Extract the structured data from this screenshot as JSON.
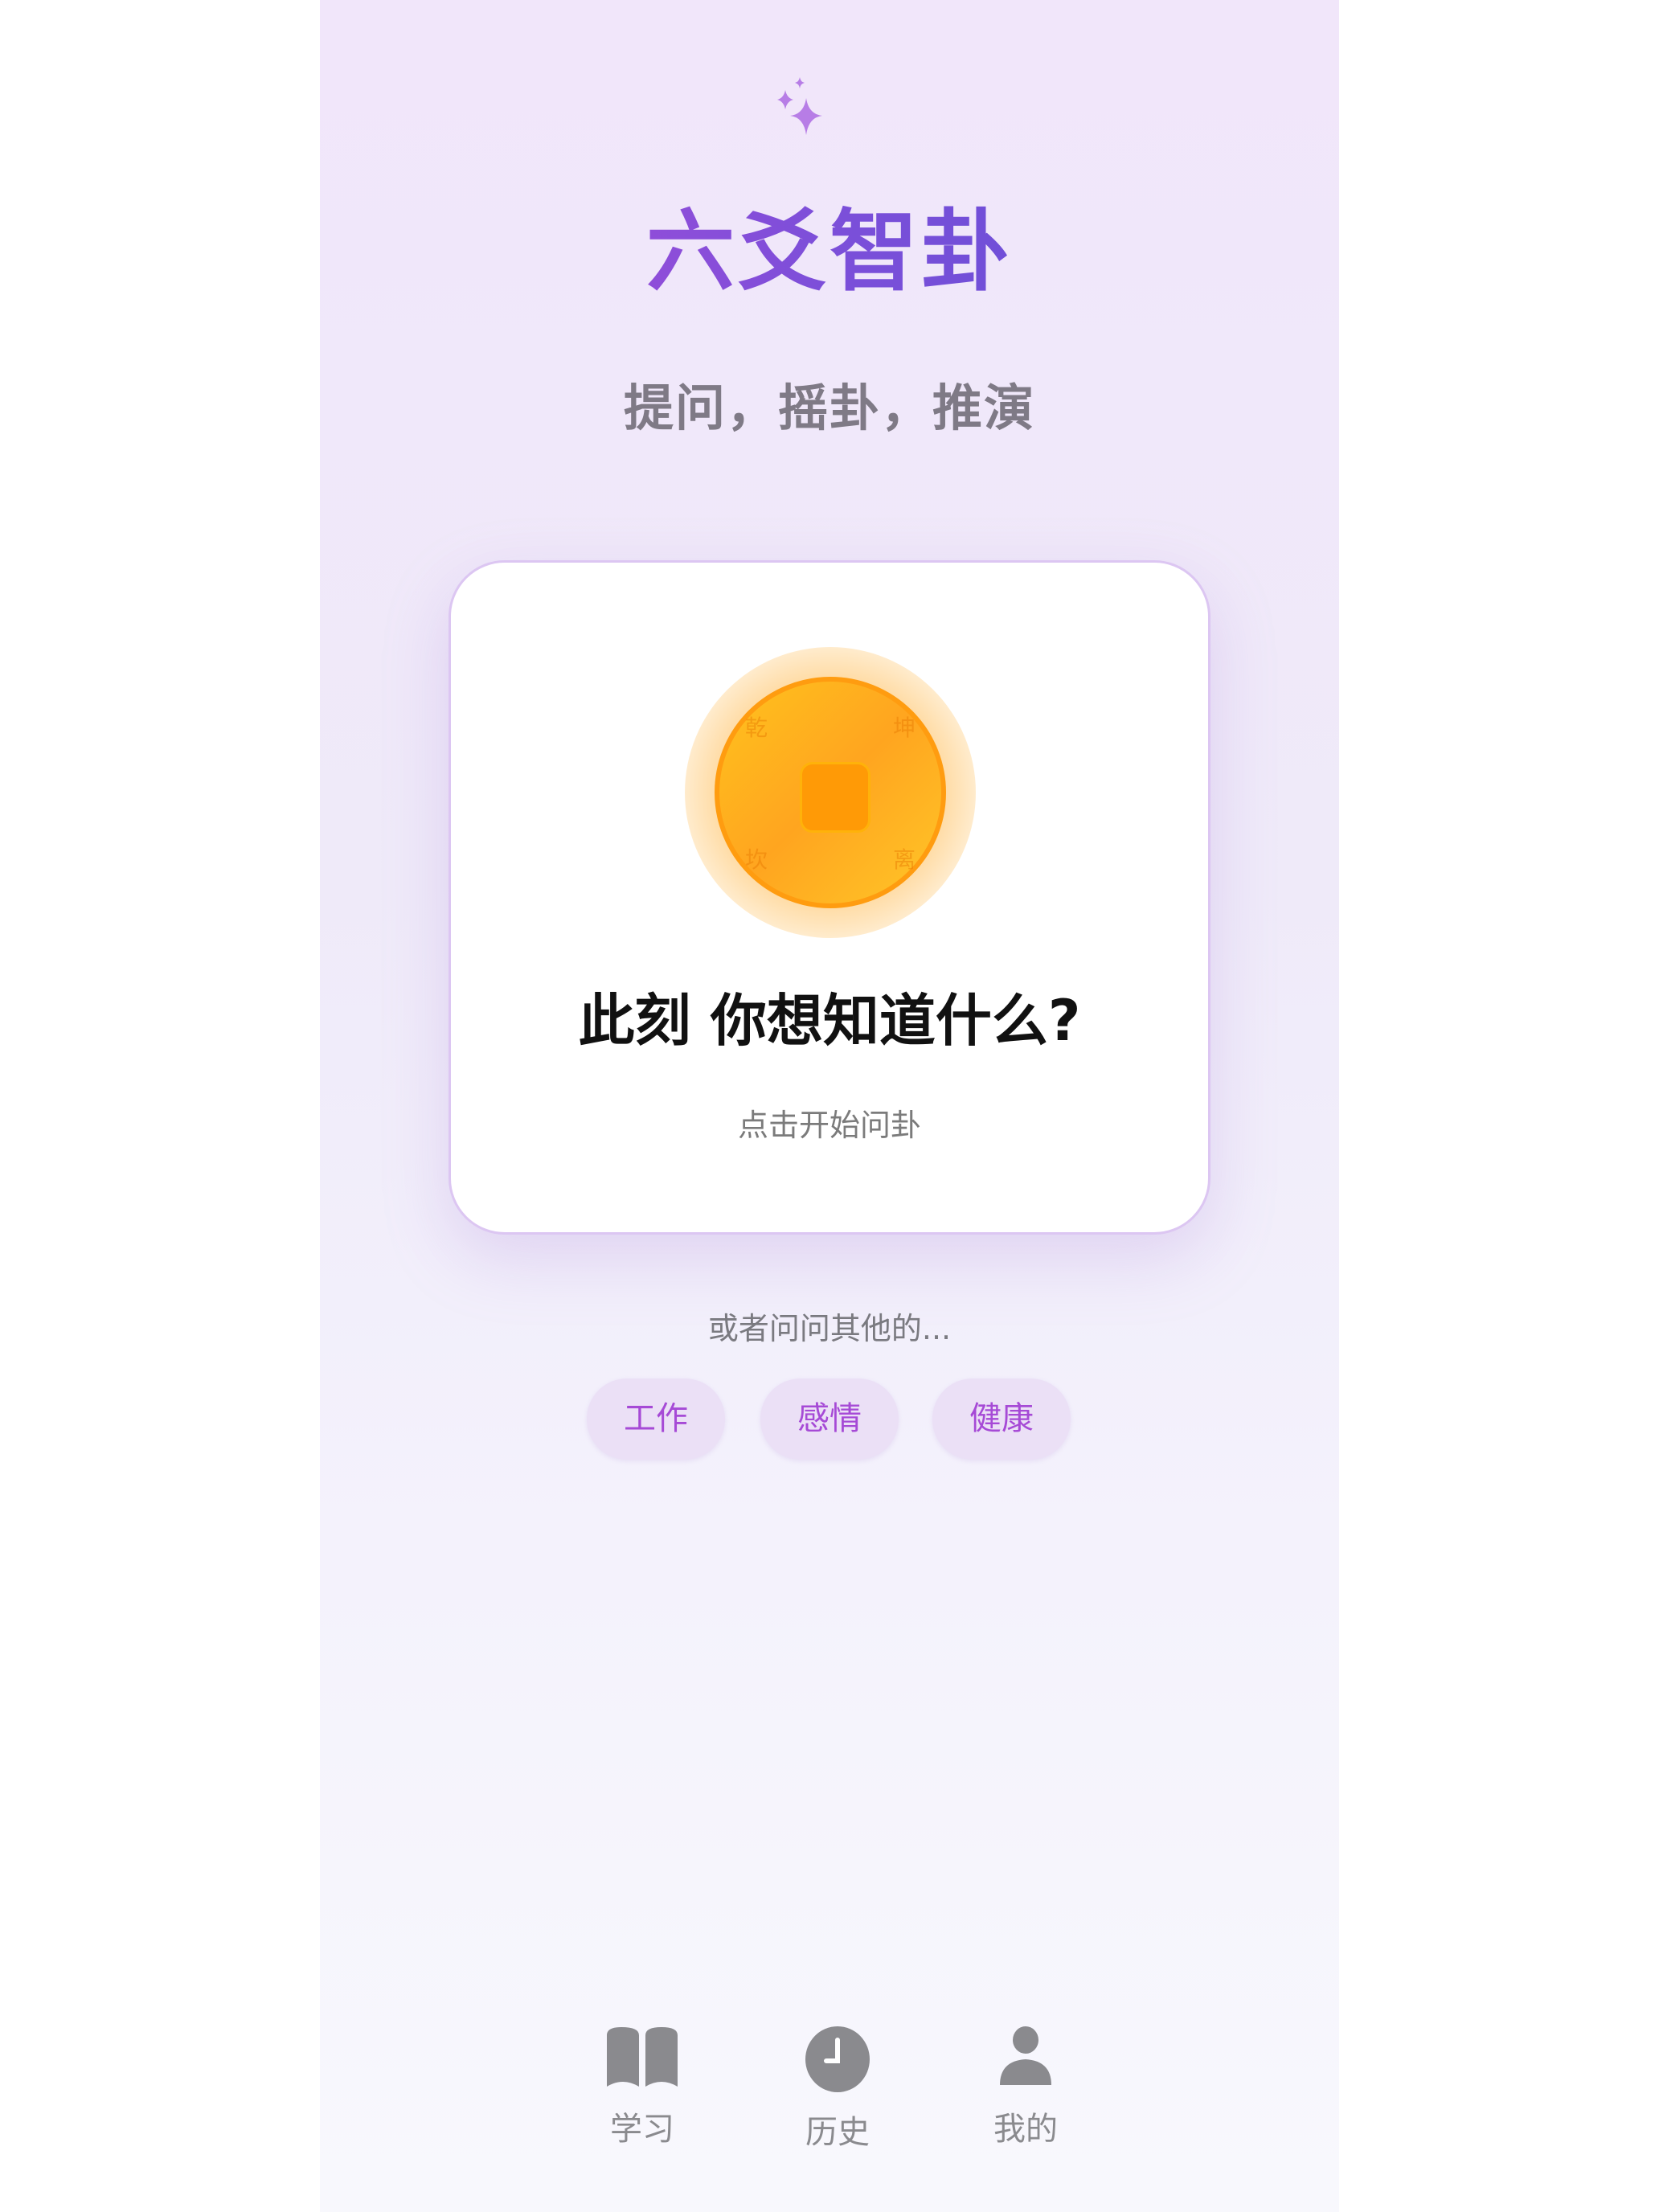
{
  "header": {
    "icon": "sparkles-icon",
    "title": "六爻智卦",
    "subtitle": "提问，摇卦，推演"
  },
  "card": {
    "coin": {
      "trigrams": [
        "乾",
        "坤",
        "坎",
        "离"
      ]
    },
    "question": "此刻 你想知道什么?",
    "hint": "点击开始问卦"
  },
  "suggestions": {
    "label": "或者问问其他的...",
    "chips": [
      "工作",
      "感情",
      "健康"
    ]
  },
  "nav": [
    {
      "label": "学习",
      "icon": "book-icon"
    },
    {
      "label": "历史",
      "icon": "clock-icon"
    },
    {
      "label": "我的",
      "icon": "person-icon"
    }
  ],
  "colors": {
    "accent": "#a64ad6",
    "coin": "#ffa51f",
    "nav_icon": "#8a8a8e"
  }
}
